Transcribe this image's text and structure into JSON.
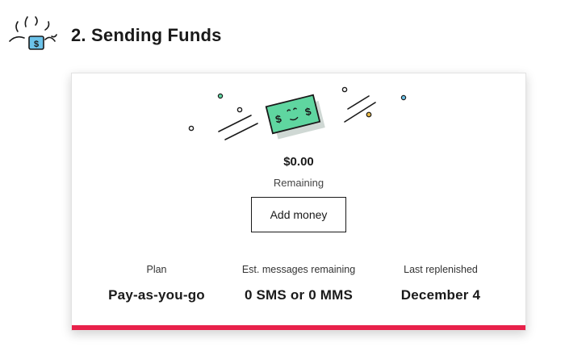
{
  "section": {
    "title": "2. Sending Funds",
    "icon": "money-burst-icon"
  },
  "card": {
    "illustration_icon": "flying-money-icon",
    "balance": "$0.00",
    "balance_caption": "Remaining",
    "add_money_label": "Add money",
    "accent_color": "#e8214a"
  },
  "stats": [
    {
      "label": "Plan",
      "value": "Pay-as-you-go"
    },
    {
      "label": "Est. messages remaining",
      "value": "0 SMS or 0 MMS"
    },
    {
      "label": "Last replenished",
      "value": "December 4"
    }
  ],
  "colors": {
    "money_green": "#5fd6a0",
    "money_blue": "#6cc3ea",
    "accent_red": "#e8214a",
    "dot_yellow": "#e8b94a"
  }
}
